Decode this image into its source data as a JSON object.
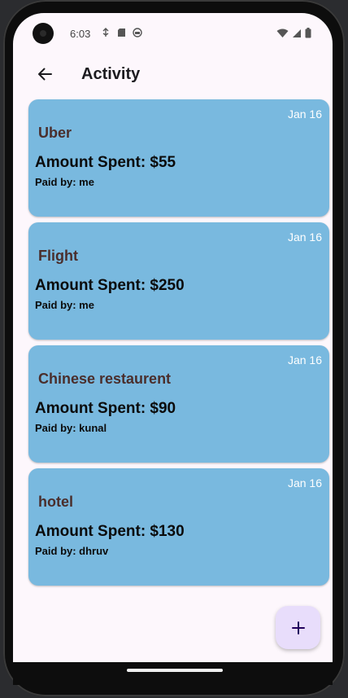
{
  "status_bar": {
    "time": "6:03"
  },
  "app_bar": {
    "title": "Activity"
  },
  "expenses": [
    {
      "date": "Jan 16",
      "title": "Uber",
      "amount_text": "Amount Spent: $55",
      "paid_by_text": "Paid by: me"
    },
    {
      "date": "Jan 16",
      "title": "Flight",
      "amount_text": "Amount Spent: $250",
      "paid_by_text": "Paid by: me"
    },
    {
      "date": "Jan 16",
      "title": "Chinese restaurent",
      "amount_text": "Amount Spent: $90",
      "paid_by_text": "Paid by: kunal"
    },
    {
      "date": "Jan 16",
      "title": "hotel",
      "amount_text": "Amount Spent: $130",
      "paid_by_text": "Paid by: dhruv"
    }
  ],
  "fab": {
    "icon": "plus-icon"
  },
  "colors": {
    "card_background": "#79b9df",
    "card_title": "#4a2e2c",
    "fab_background": "#e8ddfb",
    "screen_background": "#fdf7fc"
  }
}
